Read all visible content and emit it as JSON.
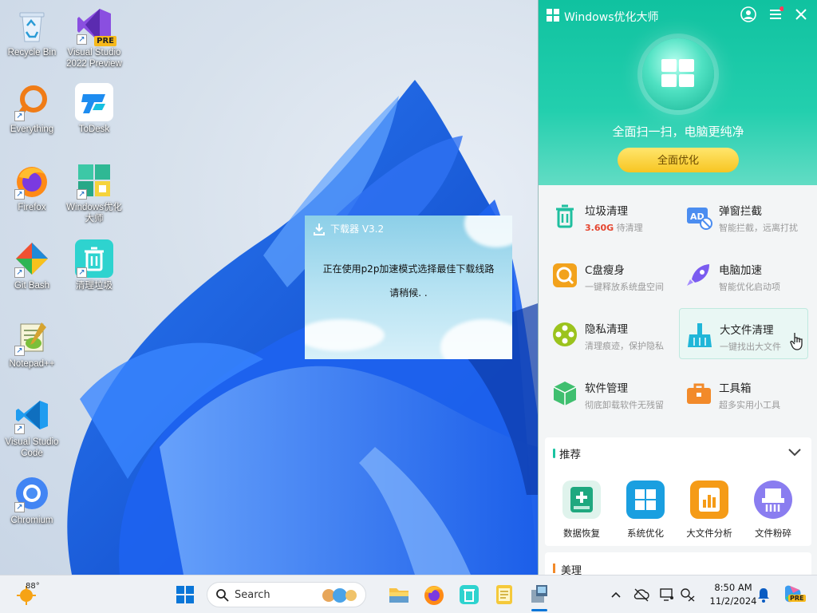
{
  "desktop": {
    "icons": [
      {
        "label": "Recycle Bin",
        "icon": "recycle-bin-icon"
      },
      {
        "label": "Visual Studio 2022 Preview",
        "icon": "visual-studio-preview-icon",
        "badge": "PRE"
      },
      {
        "label": "Everything",
        "icon": "everything-search-icon"
      },
      {
        "label": "ToDesk",
        "icon": "todesk-icon"
      },
      {
        "label": "Firefox",
        "icon": "firefox-icon"
      },
      {
        "label": "Windows优化大师",
        "icon": "windows-optimizer-icon"
      },
      {
        "label": "Git Bash",
        "icon": "git-bash-icon"
      },
      {
        "label": "清理垃圾",
        "icon": "trash-cleaner-icon"
      },
      {
        "label": "Notepad++",
        "icon": "notepad-plus-plus-icon"
      },
      {
        "label": "Visual Studio Code",
        "icon": "vscode-icon"
      },
      {
        "label": "Chromium",
        "icon": "chromium-icon"
      }
    ]
  },
  "downloader": {
    "title": "下载器 V3.2",
    "message": "正在使用p2p加速模式选择最佳下载线路",
    "wait": "请稍候. ."
  },
  "optimizer": {
    "app_name": "Windows优化大师",
    "scan_text": "全面扫一扫，电脑更纯净",
    "optimize_button": "全面优化",
    "tiles": [
      {
        "name": "垃圾清理",
        "sub_value": "3.60G",
        "sub": "待清理",
        "color": "#1fbf9f"
      },
      {
        "name": "弹窗拦截",
        "sub": "智能拦截，远离打扰",
        "color": "#4b8df0"
      },
      {
        "name": "C盘瘦身",
        "sub": "一键释放系统盘空间",
        "color": "#f2a21c"
      },
      {
        "name": "电脑加速",
        "sub": "智能优化启动项",
        "color": "#7b5cf0"
      },
      {
        "name": "隐私清理",
        "sub": "清理痕迹，保护隐私",
        "color": "#9bc31d"
      },
      {
        "name": "大文件清理",
        "sub": "一键找出大文件",
        "color": "#20b6d8"
      },
      {
        "name": "软件管理",
        "sub": "彻底卸载软件无残留",
        "color": "#3fbf6f"
      },
      {
        "name": "工具箱",
        "sub": "超多实用小工具",
        "color": "#f28a2a"
      }
    ],
    "recommend": {
      "title": "推荐",
      "items": [
        {
          "label": "数据恢复",
          "color": "#1fa87f"
        },
        {
          "label": "系统优化",
          "color": "#1a9fe0"
        },
        {
          "label": "大文件分析",
          "color": "#f59b17"
        },
        {
          "label": "文件粉碎",
          "color": "#8a7df0"
        }
      ]
    },
    "more_title": "美理"
  },
  "taskbar": {
    "weather_temp": "88°",
    "search_placeholder": "Search",
    "time": "8:50 AM",
    "date": "11/2/2024",
    "copilot_badge": "PRE"
  }
}
